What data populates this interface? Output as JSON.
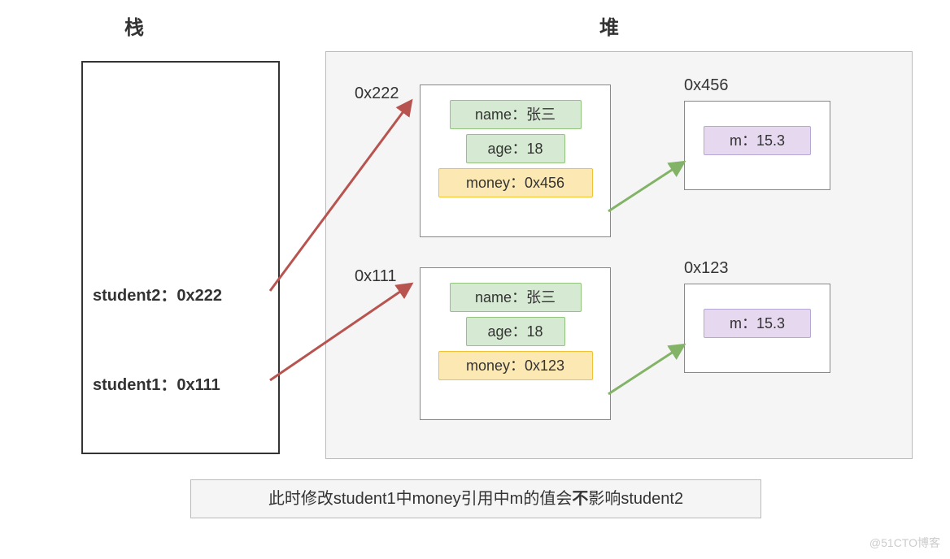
{
  "headers": {
    "stack": "栈",
    "heap": "堆"
  },
  "stack": {
    "items": [
      {
        "label": "student2：0x222"
      },
      {
        "label": "student1：0x111"
      }
    ]
  },
  "heap": {
    "obj222": {
      "addr": "0x222",
      "name_field": "name：张三",
      "age_field": "age：18",
      "money_field": "money：0x456"
    },
    "obj111": {
      "addr": "0x111",
      "name_field": "name：张三",
      "age_field": "age：18",
      "money_field": "money：0x123"
    },
    "box456": {
      "addr": "0x456",
      "m_field": "m：15.3"
    },
    "box123": {
      "addr": "0x123",
      "m_field": "m：15.3"
    }
  },
  "caption": {
    "pre": "此时修改student1中money引用中m的值会",
    "bold": "不",
    "post": "影响student2"
  },
  "watermark": "@51CTO博客",
  "colors": {
    "arrow_red": "#b85450",
    "arrow_green": "#82b366"
  }
}
